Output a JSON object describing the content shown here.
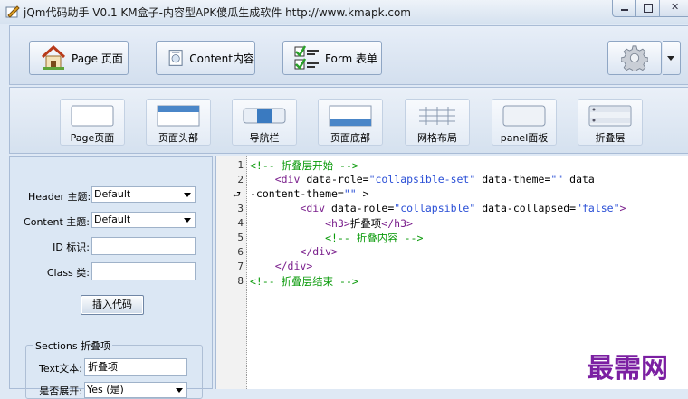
{
  "window": {
    "title": "jQm代码助手 V0.1   KM盒子-内容型APK傻瓜生成软件 http://www.kmapk.com"
  },
  "toolbar": {
    "buttons": [
      {
        "label": "Page 页面",
        "icon": "house-icon"
      },
      {
        "label": "Content内容",
        "icon": "document-icon"
      },
      {
        "label": "Form 表单",
        "icon": "checklist-icon"
      }
    ],
    "settings_icon": "gear-icon"
  },
  "components": [
    {
      "label": "Page页面"
    },
    {
      "label": "页面头部"
    },
    {
      "label": "导航栏"
    },
    {
      "label": "页面底部"
    },
    {
      "label": "网格布局"
    },
    {
      "label": "panel面板"
    },
    {
      "label": "折叠层"
    }
  ],
  "form": {
    "header_theme_label": "Header 主题:",
    "header_theme_value": "Default",
    "content_theme_label": "Content 主题:",
    "content_theme_value": "Default",
    "id_label": "ID 标识:",
    "id_value": "",
    "class_label": "Class 类:",
    "class_value": "",
    "insert_button": "插入代码",
    "sections_legend": "Sections 折叠项",
    "text_label": "Text文本:",
    "text_value": "折叠项",
    "expand_label": "是否展开:",
    "expand_value": "Yes (是)"
  },
  "editor": {
    "line_numbers": [
      "1",
      "2",
      "",
      "3",
      "4",
      "5",
      "6",
      "7",
      "8"
    ],
    "lines": {
      "l1": "<!-- 折叠层开始 -->",
      "l2a": "<div ",
      "l2b": "data-role=",
      "l2c": "\"collapsible-set\"",
      "l2d": " data-theme=",
      "l2e": "\"\"",
      "l2f": " data",
      "l2g": "-content-theme=",
      "l2h": "\"\"",
      "l2i": " >",
      "l3a": "<div ",
      "l3b": "data-role=",
      "l3c": "\"collapsible\"",
      "l3d": " data-collapsed=",
      "l3e": "\"false\"",
      "l3f": ">",
      "l4a": "<h3>",
      "l4b": "折叠项",
      "l4c": "</h3>",
      "l5": "<!-- 折叠内容 -->",
      "l6": "</div>",
      "l7": "</div>",
      "l8": "<!-- 折叠层结束 -->"
    }
  },
  "watermark": "最需网"
}
